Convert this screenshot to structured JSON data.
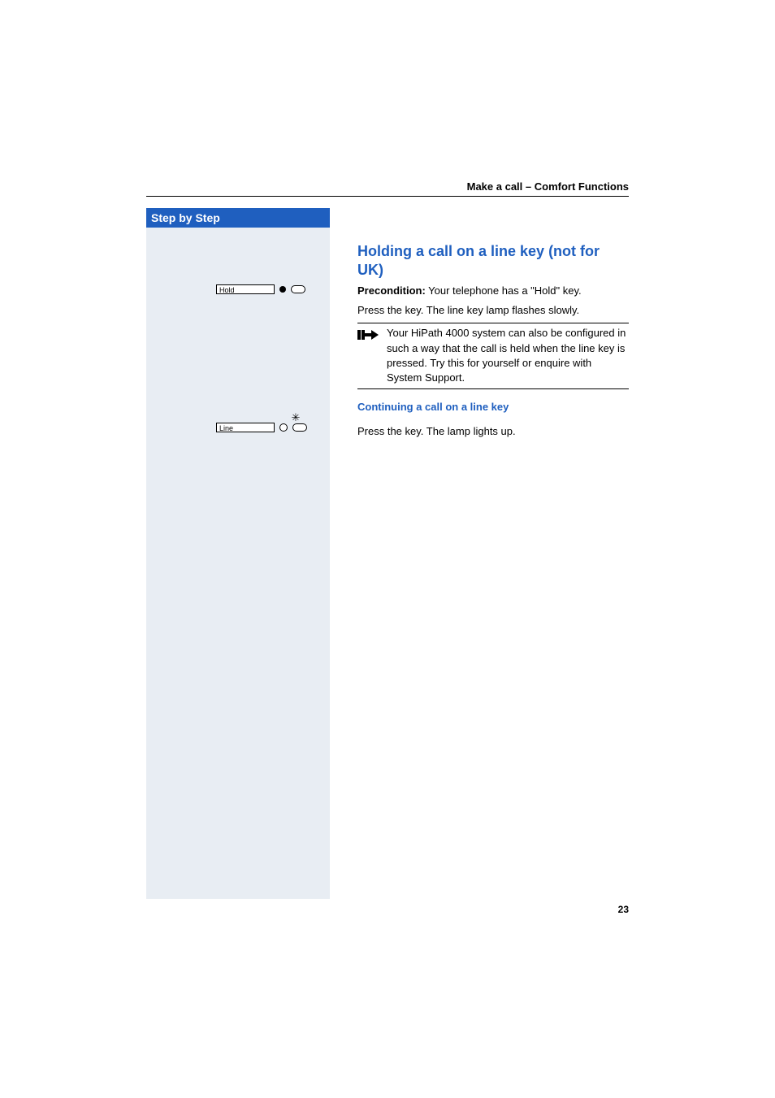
{
  "header": {
    "title": "Make a call – Comfort Functions"
  },
  "sidebar": {
    "title": "Step by Step",
    "keys": {
      "hold_label": "Hold",
      "line_label": "Line"
    }
  },
  "content": {
    "heading": "Holding a call on a line key (not for UK)",
    "precondition_label": "Precondition:",
    "precondition_text": " Your telephone has a \"Hold\" key.",
    "press_hold": "Press the key. The line key lamp flashes slowly.",
    "note": "Your HiPath 4000 system can also be configured in such a way that the call is held when the line key is pressed. Try this for yourself or enquire with System Support.",
    "sub_heading": "Continuing a call on a line key",
    "press_line": "Press the key. The lamp lights up."
  },
  "page_number": "23"
}
